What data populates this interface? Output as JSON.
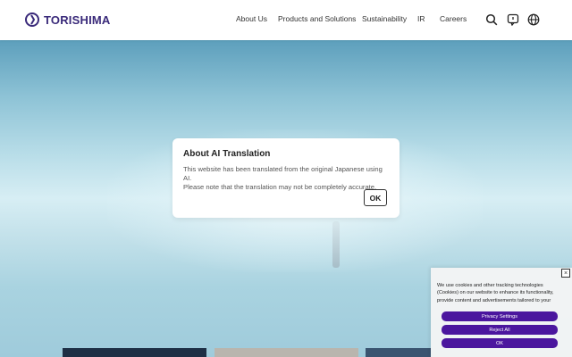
{
  "header": {
    "logo_text": "TORISHIMA",
    "nav": [
      "About Us",
      "Products and Solutions",
      "Sustainability",
      "IR",
      "Careers"
    ],
    "icons": [
      "search-icon",
      "chat-icon",
      "globe-icon"
    ]
  },
  "modal": {
    "title": "About AI Translation",
    "body_line1": "This website has been translated from the original Japanese using AI.",
    "body_line2": "Please note that the translation may not be completely accurate.",
    "ok_label": "OK"
  },
  "cookie": {
    "close_label": "×",
    "text": "We use cookies and other tracking technologies (Cookies) on our website to enhance its functionality, provide content and advertisements tailored to your",
    "privacy_label": "Privacy Settings",
    "reject_label": "Reject All",
    "ok_label": "OK"
  },
  "colors": {
    "brand": "#3a2a7a",
    "cookie_button": "#4b169e"
  }
}
